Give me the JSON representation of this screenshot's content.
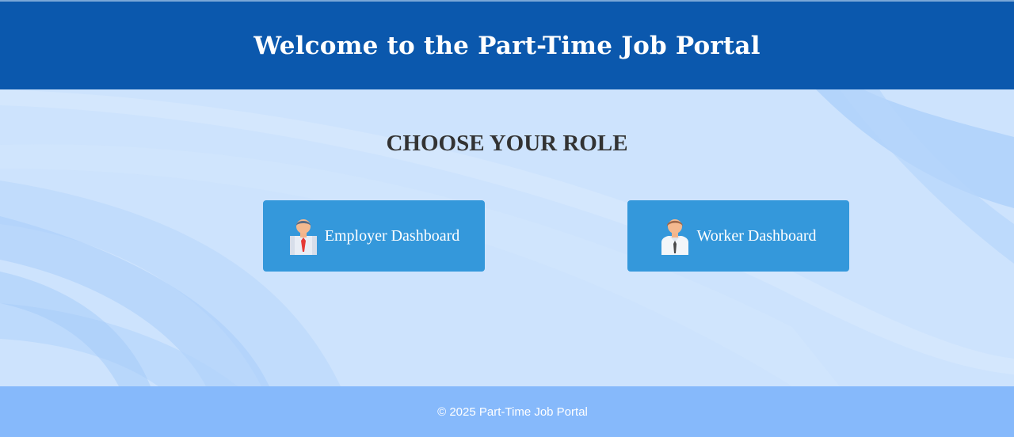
{
  "header": {
    "title": "Welcome to the Part-Time Job Portal"
  },
  "main": {
    "heading": "CHOOSE YOUR ROLE",
    "roles": [
      {
        "label": "Employer Dashboard",
        "icon": "employer-avatar-icon"
      },
      {
        "label": "Worker Dashboard",
        "icon": "worker-avatar-icon"
      }
    ]
  },
  "footer": {
    "copyright": "© 2025 Part-Time Job Portal"
  },
  "colors": {
    "header_bg": "#0b58ad",
    "main_bg": "#cde3fd",
    "button_bg": "#3498db",
    "footer_bg": "#86b9fb",
    "heading_text": "#333333"
  }
}
